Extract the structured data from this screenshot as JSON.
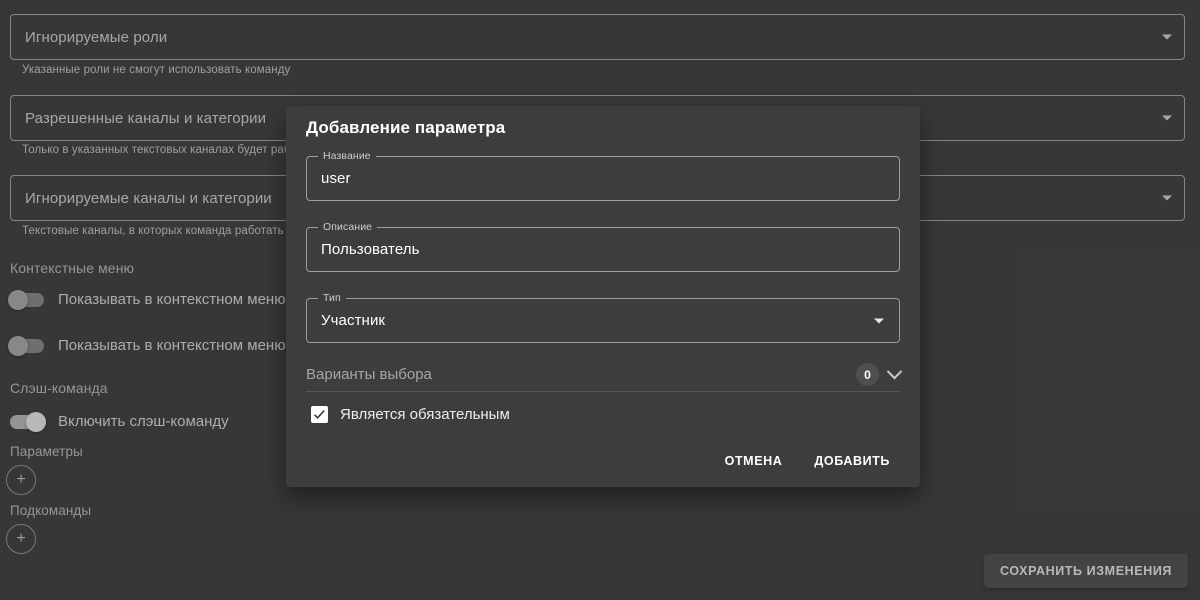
{
  "background": {
    "fields": [
      {
        "label": "Игнорируемые роли",
        "helper": "Указанные роли не смогут использовать команду"
      },
      {
        "label": "Разрешенные каналы и категории",
        "helper": "Только в указанных текстовых каналах будет работать"
      },
      {
        "label": "Игнорируемые каналы и категории",
        "helper": "Текстовые каналы, в которых команда работать не буде"
      }
    ],
    "context_menu_section": "Контекстные меню",
    "toggles": [
      {
        "label": "Показывать в контекстном меню сооб",
        "on": false
      },
      {
        "label": "Показывать в контекстном меню участ",
        "on": false
      }
    ],
    "slash_section": "Слэш-команда",
    "slash_toggle": {
      "label": "Включить слэш-команду",
      "on": true
    },
    "parameters_label": "Параметры",
    "subcommands_label": "Подкоманды",
    "add_icon": "+",
    "save_label": "СОХРАНИТЬ ИЗМЕНЕНИЯ"
  },
  "dialog": {
    "title": "Добавление параметра",
    "name_field": {
      "legend": "Название",
      "value": "user"
    },
    "description_field": {
      "legend": "Описание",
      "value": "Пользователь"
    },
    "type_field": {
      "legend": "Тип",
      "value": "Участник"
    },
    "choices": {
      "label": "Варианты выбора",
      "count": "0"
    },
    "required": {
      "label": "Является обязательным",
      "checked": true
    },
    "cancel_label": "ОТМЕНА",
    "confirm_label": "ДОБАВИТЬ"
  },
  "colors": {
    "page_bg": "#4d4d4d",
    "dialog_bg": "#3d3d3d",
    "accent_text": "#ffffff"
  }
}
